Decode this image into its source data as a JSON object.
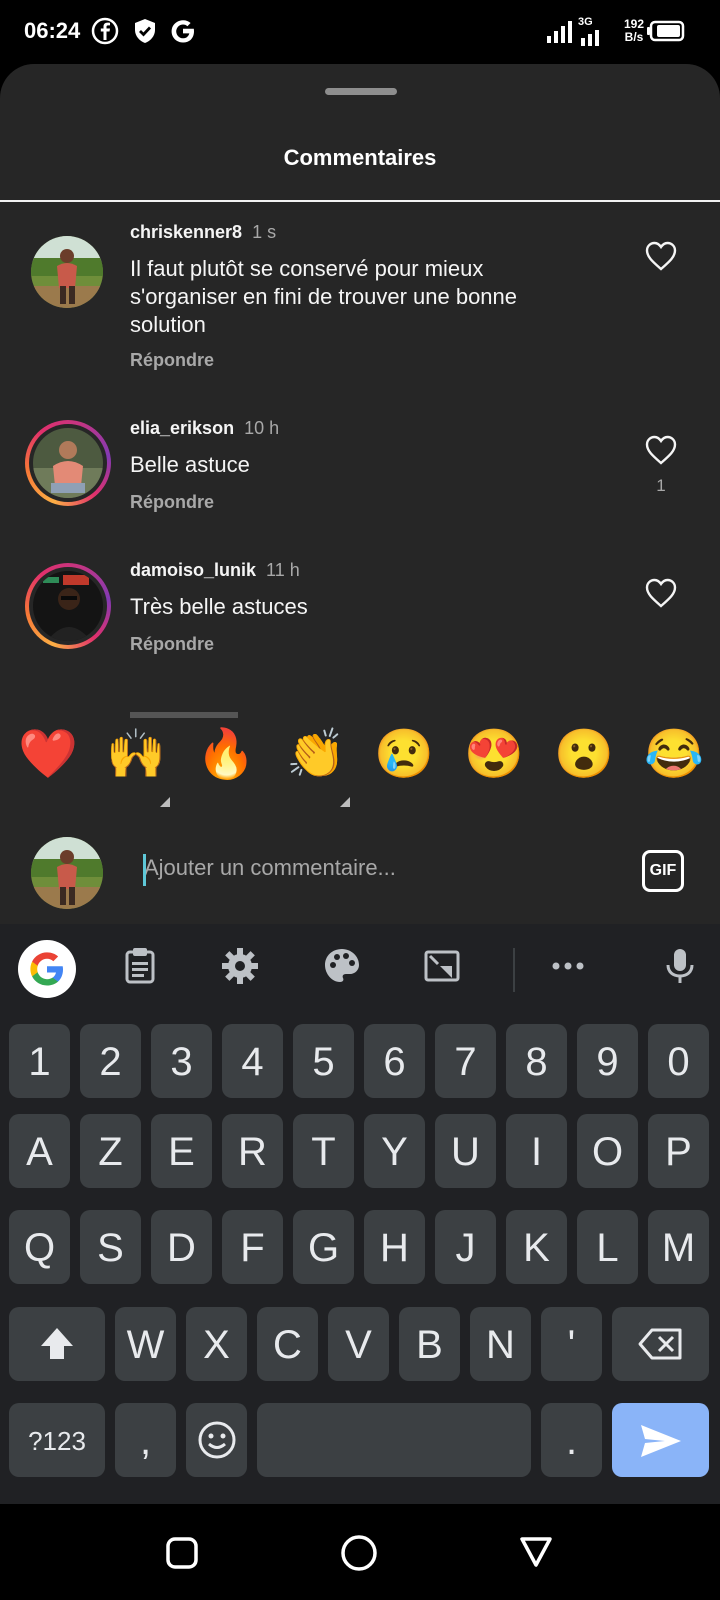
{
  "status_bar": {
    "time": "06:24",
    "icons": [
      "facebook-icon",
      "shield-check-icon",
      "google-icon",
      "signal-icon",
      "battery-icon"
    ],
    "network": "3G",
    "speed_value": "192",
    "speed_unit": "B/s"
  },
  "sheet": {
    "title": "Commentaires"
  },
  "comments": [
    {
      "username": "chriskenner8",
      "time": "1 s",
      "text": "Il faut plutôt se conservé pour mieux s'organiser en fini de trouver une bonne solution",
      "reply_label": "Répondre",
      "likes": ""
    },
    {
      "username": "elia_erikson",
      "time": "10 h",
      "text": "Belle astuce",
      "reply_label": "Répondre",
      "likes": "1"
    },
    {
      "username": "damoiso_lunik",
      "time": "11 h",
      "text": "Très belle astuces",
      "reply_label": "Répondre",
      "likes": ""
    }
  ],
  "emoji_bar": [
    "❤️",
    "🙌",
    "🔥",
    "👏",
    "😢",
    "😍",
    "😮",
    "😂"
  ],
  "composer": {
    "placeholder": "Ajouter un commentaire...",
    "gif_label": "GIF"
  },
  "keyboard": {
    "row_numbers": [
      "1",
      "2",
      "3",
      "4",
      "5",
      "6",
      "7",
      "8",
      "9",
      "0"
    ],
    "row_1": [
      "A",
      "Z",
      "E",
      "R",
      "T",
      "Y",
      "U",
      "I",
      "O",
      "P"
    ],
    "row_2": [
      "Q",
      "S",
      "D",
      "F",
      "G",
      "H",
      "J",
      "K",
      "L",
      "M"
    ],
    "row_3": [
      "W",
      "X",
      "C",
      "V",
      "B",
      "N",
      "'"
    ],
    "symbols_label": "?123",
    "comma_label": ",",
    "period_label": "."
  },
  "colors": {
    "sheet_bg": "#262626",
    "keyboard_bg": "#202124",
    "key_bg": "#3c4043",
    "send_key": "#8ab4f8",
    "story_ring": "#e1306c"
  }
}
